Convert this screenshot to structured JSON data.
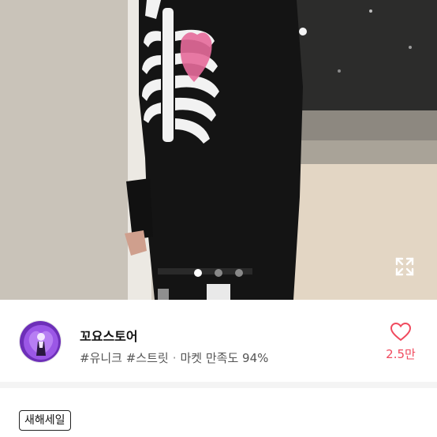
{
  "gallery": {
    "page_count": 3,
    "active_index": 0
  },
  "store": {
    "name": "꼬요스토어",
    "tags": "#유니크 #스트릿",
    "separator": "·",
    "satisfaction": "마켓 만족도 94%",
    "like_count": "2.5만"
  },
  "labels": [
    "새해세일"
  ],
  "colors": {
    "like_accent": "#f04a5e",
    "avatar_ring": "#8a3fd8"
  },
  "icons": [
    "expand-icon",
    "heart-outline-icon"
  ]
}
